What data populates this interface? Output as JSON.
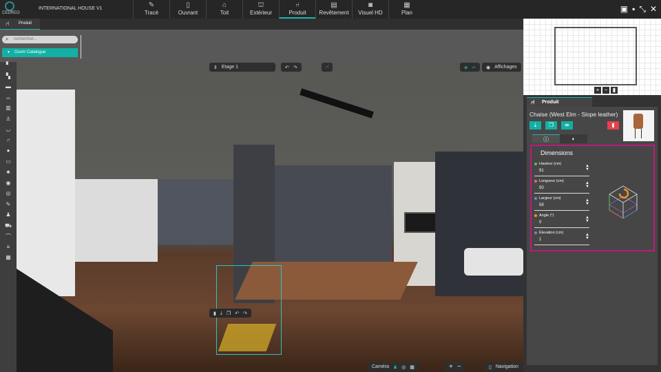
{
  "app": {
    "logo_text": "CEDREO",
    "project_title": "INTERNATIONAL HOUSE V1"
  },
  "modes": [
    {
      "label": "Tracé",
      "icon": "pencil-icon"
    },
    {
      "label": "Ouvrant",
      "icon": "door-icon"
    },
    {
      "label": "Toit",
      "icon": "roof-icon"
    },
    {
      "label": "Extérieur",
      "icon": "house-icon"
    },
    {
      "label": "Produit",
      "icon": "furniture-icon",
      "active": true
    },
    {
      "label": "Revêtement",
      "icon": "paint-roller-icon"
    },
    {
      "label": "Visuel HD",
      "icon": "camera-icon"
    },
    {
      "label": "Plan",
      "icon": "plan-icon"
    }
  ],
  "window_icons": [
    "comment-icon",
    "save-icon",
    "collapse-icon",
    "close-icon"
  ],
  "subtab": {
    "label": "Produit"
  },
  "library": {
    "search_placeholder": "rechercher...",
    "catalog_button": "Ouvrir Catalogue"
  },
  "viewport": {
    "floor_select": "Etage 1",
    "displays_label": "Affichages",
    "camera_label": "Caméra",
    "navigation_label": "Navigation"
  },
  "product": {
    "tab_label": "Produit",
    "name": "Chaise (West Elm - Slope leather)",
    "section_title": "Dimensions",
    "fields": [
      {
        "label": "Hauteur (cm)",
        "value": "91",
        "color": "#5cbf5c"
      },
      {
        "label": "Longueur (cm)",
        "value": "50",
        "color": "#e07070"
      },
      {
        "label": "Largeur (cm)",
        "value": "59",
        "color": "#5a8fe0"
      },
      {
        "label": "Angle (°)",
        "value": "0",
        "color": "#f0921e"
      },
      {
        "label": "Élevation (cm)",
        "value": "1",
        "color": "#9a6fd0"
      }
    ]
  },
  "colors": {
    "accent": "#12b0a5",
    "highlight": "#c0197a",
    "delete": "#e8404a"
  }
}
